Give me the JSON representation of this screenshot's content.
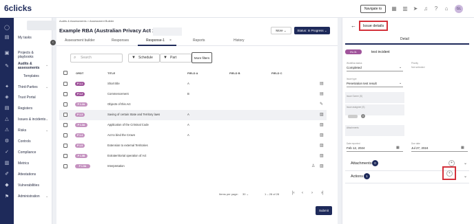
{
  "app": {
    "logo": "6clicks",
    "navigate_button": "Navigate to",
    "user_initials": "GL"
  },
  "menu": {
    "items": [
      "My tasks",
      "Projects & playbooks",
      "Audits & assessments",
      "Templates",
      "Third-Parties",
      "Trust Portal",
      "Registers",
      "Issues & incidents",
      "Risks",
      "Controls",
      "Compliance",
      "Metrics",
      "Attestations",
      "Vulnerabilities",
      "Administration"
    ]
  },
  "main": {
    "breadcrumb": "Audits & Assessments  >  Assessment Builder",
    "title": "Example RBA (Australian Privacy Act 1988)",
    "more_button": "More",
    "status_button": "Status: In Progress",
    "tabs": [
      "Assessment builder",
      "Responses",
      "Response-1",
      "Reports",
      "History"
    ],
    "search_placeholder": "Search",
    "filter_schedule": "Schedule",
    "filter_part": "Part",
    "more_filters": "More filters",
    "columns": [
      "ORDT",
      "TITLE",
      "FIELD A",
      "FIELD B",
      "FIELD C"
    ],
    "rows": [
      {
        "pill": "P 1.1",
        "title": "Short title",
        "a": "A"
      },
      {
        "pill": "P 1.2",
        "title": "Commencement",
        "a": "B"
      },
      {
        "pill": "P 1.2A",
        "title": "Objects of this Act",
        "a": ""
      },
      {
        "pill": "P 1.3",
        "title": "Saving of certain State and Territory laws",
        "a": "A"
      },
      {
        "pill": "P 1.3A",
        "title": "Application of the Criminal Code",
        "a": "A"
      },
      {
        "pill": "P 1.4",
        "title": "Act to bind the Crown",
        "a": "A"
      },
      {
        "pill": "P 1.5",
        "title": "Extension to external Territories",
        "a": ""
      },
      {
        "pill": "P 1.5B",
        "title": "Extraterritorial operation of Act",
        "a": ""
      },
      {
        "pill": "P 1.5A",
        "title": "Interpretation",
        "a": ""
      }
    ],
    "pagination": {
      "items_label": "Items per page:",
      "per_page": "30",
      "range": "1 – 28 of 28"
    },
    "submit": "Submit"
  },
  "panel": {
    "title": "Issue details",
    "tab": "Detail",
    "id": "IN-01",
    "name": "test incident",
    "fields": [
      {
        "label": "Workflow status",
        "value": "Completed"
      },
      {
        "label": "Priority",
        "value": "Not selected"
      },
      {
        "label": "Issue type",
        "value": "Penetration test result"
      },
      {
        "label": "Issue Owner (S)",
        "value": ""
      },
      {
        "label": "Issue assignee (S)",
        "value": ""
      },
      {
        "label": "Attachments",
        "value": ""
      },
      {
        "label": "Date reported",
        "value": "Feb 12, 2024"
      },
      {
        "label": "Due date",
        "value": "Jul 27, 2024"
      }
    ],
    "attachments_label": "Attachments",
    "attachments_count": "0",
    "actions_label": "Actions",
    "actions_count": "1"
  }
}
